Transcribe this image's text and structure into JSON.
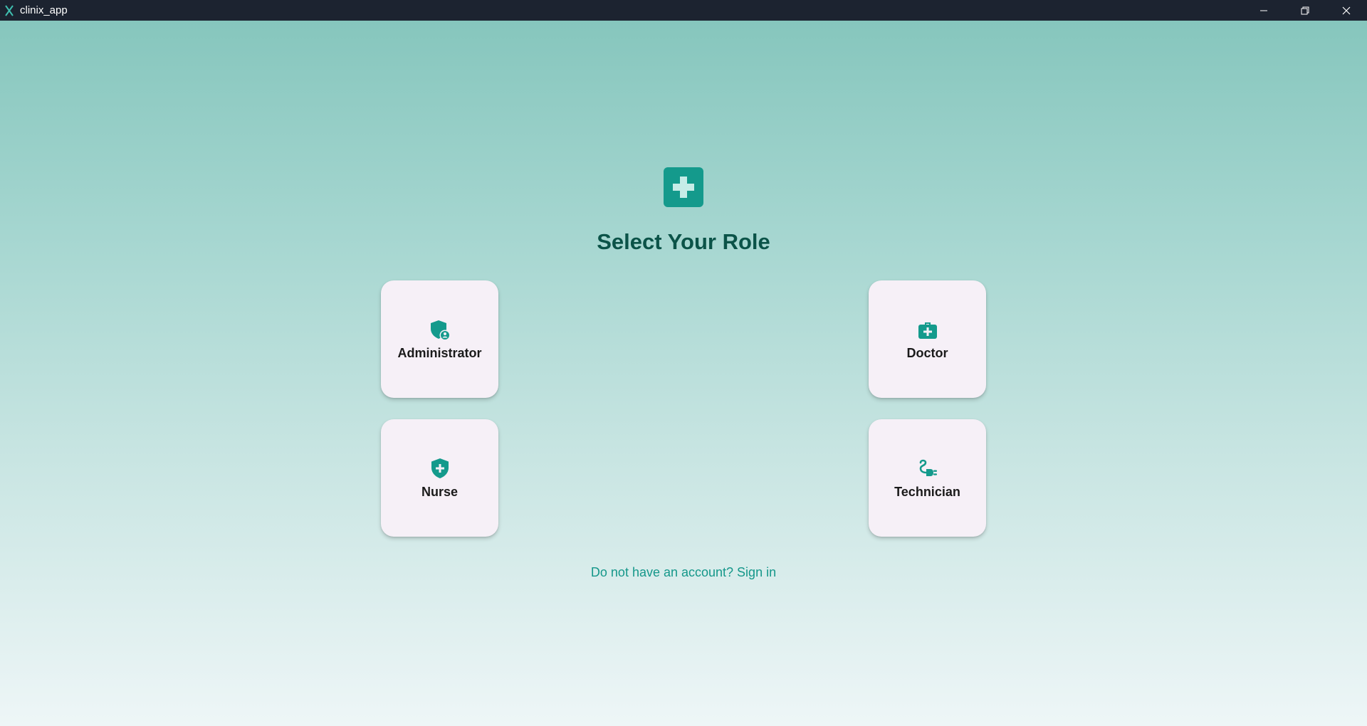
{
  "window": {
    "title": "clinix_app",
    "icon": "x-logo-icon",
    "controls": [
      "minimize-icon",
      "restore-icon",
      "close-icon"
    ]
  },
  "logo": {
    "icon": "medical-cross-icon",
    "color": "#149a8c"
  },
  "heading": "Select Your Role",
  "roles": [
    {
      "label": "Administrator",
      "icon": "admin-shield-icon"
    },
    {
      "label": "Doctor",
      "icon": "medical-bag-icon"
    },
    {
      "label": "Nurse",
      "icon": "health-shield-icon"
    },
    {
      "label": "Technician",
      "icon": "plug-icon"
    }
  ],
  "signin_link": "Do not have an account? Sign in",
  "colors": {
    "accent": "#149a8c",
    "heading": "#0b5348",
    "card_bg": "#f6f0f7",
    "titlebar": "#1c2330"
  }
}
